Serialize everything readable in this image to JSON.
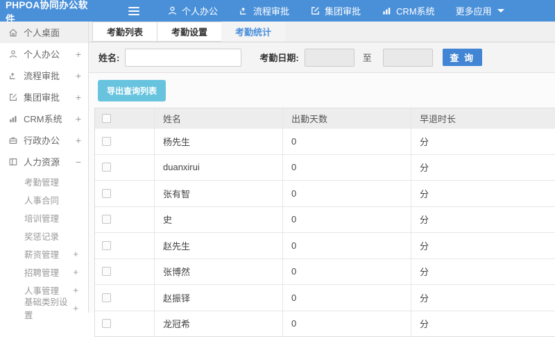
{
  "app": {
    "title": "PHPOA协同办公软件"
  },
  "topnav": {
    "items": [
      {
        "icon": "user-icon",
        "label": "个人办公"
      },
      {
        "icon": "workflow-icon",
        "label": "流程审批"
      },
      {
        "icon": "edit-icon",
        "label": "集团审批"
      },
      {
        "icon": "chart-icon",
        "label": "CRM系统"
      },
      {
        "icon": "caret-down-icon",
        "label": "更多应用"
      }
    ]
  },
  "sidebar": {
    "items": [
      {
        "icon": "home-icon",
        "label": "个人桌面",
        "expand": ""
      },
      {
        "icon": "user-icon",
        "label": "个人办公",
        "expand": "+"
      },
      {
        "icon": "workflow-icon",
        "label": "流程审批",
        "expand": "+"
      },
      {
        "icon": "edit-icon",
        "label": "集团审批",
        "expand": "+"
      },
      {
        "icon": "chart-icon",
        "label": "CRM系统",
        "expand": "+"
      },
      {
        "icon": "briefcase-icon",
        "label": "行政办公",
        "expand": "+"
      },
      {
        "icon": "card-icon",
        "label": "人力资源",
        "expand": "−"
      }
    ],
    "subitems": [
      {
        "label": "考勤管理",
        "expand": ""
      },
      {
        "label": "人事合同",
        "expand": ""
      },
      {
        "label": "培训管理",
        "expand": ""
      },
      {
        "label": "奖惩记录",
        "expand": ""
      },
      {
        "label": "薪资管理",
        "expand": "+"
      },
      {
        "label": "招聘管理",
        "expand": "+"
      },
      {
        "label": "人事管理",
        "expand": "+"
      },
      {
        "label": "基础类别设置",
        "expand": "+"
      }
    ]
  },
  "tabs": [
    {
      "label": "考勤列表"
    },
    {
      "label": "考勤设置"
    },
    {
      "label": "考勤统计"
    }
  ],
  "filters": {
    "name_label": "姓名:",
    "name_value": "",
    "date_label": "考勤日期:",
    "date_from": "",
    "to_label": "至",
    "date_to": "",
    "search_label": "查 询"
  },
  "toolbar": {
    "export_label": "导出查询列表"
  },
  "table": {
    "headers": [
      "姓名",
      "出勤天数",
      "早退时长"
    ],
    "rows": [
      {
        "name": "杨先生",
        "days": "0",
        "late": "分"
      },
      {
        "name": "duanxirui",
        "days": "0",
        "late": "分"
      },
      {
        "name": "张有智",
        "days": "0",
        "late": "分"
      },
      {
        "name": "史",
        "days": "0",
        "late": "分"
      },
      {
        "name": "赵先生",
        "days": "0",
        "late": "分"
      },
      {
        "name": "张博然",
        "days": "0",
        "late": "分"
      },
      {
        "name": "赵振铎",
        "days": "0",
        "late": "分"
      },
      {
        "name": "龙冠希",
        "days": "0",
        "late": "分"
      }
    ]
  },
  "colors": {
    "header_blue": "#4a90d9",
    "accent_blue": "#4285d4",
    "export_blue": "#68c4de"
  }
}
